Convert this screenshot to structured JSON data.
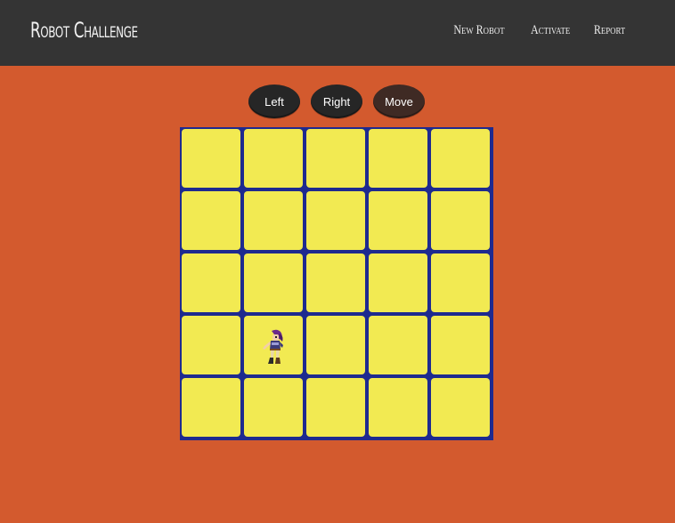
{
  "navbar": {
    "brand": "Robot Challenge",
    "links": [
      "New Robot",
      "Activate",
      "Report"
    ]
  },
  "controls": {
    "left_label": "Left",
    "right_label": "Right",
    "move_label": "Move"
  },
  "board": {
    "rows": 5,
    "cols": 5,
    "robot": {
      "row": 4,
      "col": 2
    }
  },
  "colors": {
    "background": "#d35a2e",
    "navbar": "#343434",
    "cell": "#f2ea52",
    "grid_lines": "#1e2a8f"
  }
}
